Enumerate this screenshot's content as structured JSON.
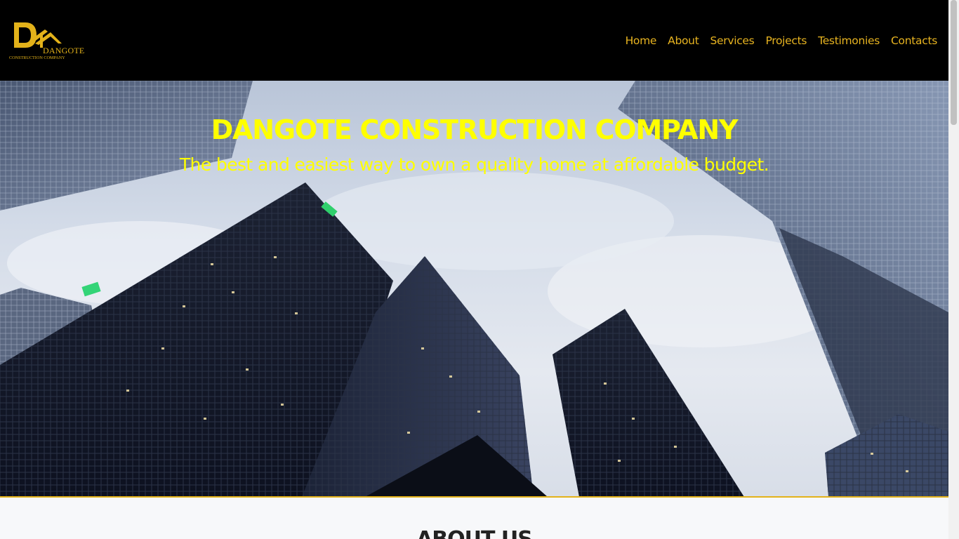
{
  "brand": {
    "name": "DANGOTE",
    "tagline": "CONSTRUCTION COMPANY",
    "logo_icon": "dk-house-logo-icon",
    "color": "#e3b21a"
  },
  "nav": {
    "items": [
      {
        "label": "Home"
      },
      {
        "label": "About"
      },
      {
        "label": "Services"
      },
      {
        "label": "Projects"
      },
      {
        "label": "Testimonies"
      },
      {
        "label": "Contacts"
      }
    ],
    "color": "#e8b420"
  },
  "hero": {
    "title": "DANGOTE CONSTRUCTION COMPANY",
    "subtitle": "The best and easiest way to own a quality home at affordable budget.",
    "text_color": "#ffff00",
    "image": "skyscrapers-photo"
  },
  "about": {
    "heading": "ABOUT US"
  }
}
